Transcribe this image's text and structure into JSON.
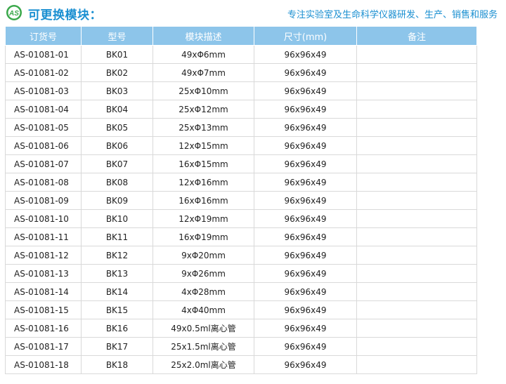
{
  "header": {
    "title": "可更换模块：",
    "tagline": "专注实验室及生命科学仪器研发、生产、销售和服务",
    "logo_letters": "AS"
  },
  "colors": {
    "accent": "#1a8fd1",
    "table_header_bg": "#8dc5ea",
    "logo_green": "#3aa84a"
  },
  "table": {
    "columns": [
      "订货号",
      "型号",
      "模块描述",
      "尺寸(mm)",
      "备注"
    ],
    "rows": [
      [
        "AS-01081-01",
        "BK01",
        "49xΦ6mm",
        "96x96x49",
        ""
      ],
      [
        "AS-01081-02",
        "BK02",
        "49xΦ7mm",
        "96x96x49",
        ""
      ],
      [
        "AS-01081-03",
        "BK03",
        "25xΦ10mm",
        "96x96x49",
        ""
      ],
      [
        "AS-01081-04",
        "BK04",
        "25xΦ12mm",
        "96x96x49",
        ""
      ],
      [
        "AS-01081-05",
        "BK05",
        "25xΦ13mm",
        "96x96x49",
        ""
      ],
      [
        "AS-01081-06",
        "BK06",
        "12xΦ15mm",
        "96x96x49",
        ""
      ],
      [
        "AS-01081-07",
        "BK07",
        "16xΦ15mm",
        "96x96x49",
        ""
      ],
      [
        "AS-01081-08",
        "BK08",
        "12xΦ16mm",
        "96x96x49",
        ""
      ],
      [
        "AS-01081-09",
        "BK09",
        "16xΦ16mm",
        "96x96x49",
        ""
      ],
      [
        "AS-01081-10",
        "BK10",
        "12xΦ19mm",
        "96x96x49",
        ""
      ],
      [
        "AS-01081-11",
        "BK11",
        "16xΦ19mm",
        "96x96x49",
        ""
      ],
      [
        "AS-01081-12",
        "BK12",
        "9xΦ20mm",
        "96x96x49",
        ""
      ],
      [
        "AS-01081-13",
        "BK13",
        "9xΦ26mm",
        "96x96x49",
        ""
      ],
      [
        "AS-01081-14",
        "BK14",
        "4xΦ28mm",
        "96x96x49",
        ""
      ],
      [
        "AS-01081-15",
        "BK15",
        "4xΦ40mm",
        "96x96x49",
        ""
      ],
      [
        "AS-01081-16",
        "BK16",
        "49x0.5ml离心管",
        "96x96x49",
        ""
      ],
      [
        "AS-01081-17",
        "BK17",
        "25x1.5ml离心管",
        "96x96x49",
        ""
      ],
      [
        "AS-01081-18",
        "BK18",
        "25x2.0ml离心管",
        "96x96x49",
        ""
      ]
    ]
  }
}
